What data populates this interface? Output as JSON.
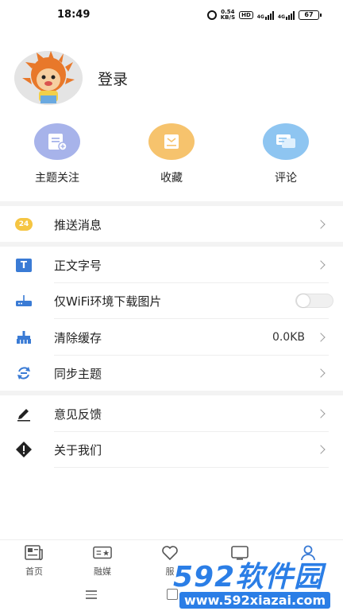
{
  "status_bar": {
    "time": "18:49",
    "speed": "0.54\nKB/S",
    "hd": "HD",
    "network_1": "4G",
    "network_2": "4G",
    "battery": "67"
  },
  "profile": {
    "login_label": "登录"
  },
  "quick_actions": [
    {
      "label": "主题关注",
      "color": "#a7b3ea"
    },
    {
      "label": "收藏",
      "color": "#f6c36d"
    },
    {
      "label": "评论",
      "color": "#8ec5f1"
    }
  ],
  "menu": {
    "push": {
      "label": "推送消息",
      "icon_text": "24"
    },
    "font_size": {
      "label": "正文字号",
      "icon_text": "T"
    },
    "wifi_images": {
      "label": "仅WiFi环境下载图片",
      "enabled": false
    },
    "clear_cache": {
      "label": "清除缓存",
      "value": "0.0KB"
    },
    "sync_topics": {
      "label": "同步主题"
    },
    "feedback": {
      "label": "意见反馈"
    },
    "about": {
      "label": "关于我们"
    }
  },
  "bottom_nav": [
    {
      "label": "首页",
      "icon": "newspaper-icon"
    },
    {
      "label": "融媒",
      "icon": "media-icon"
    },
    {
      "label": "服",
      "icon": "heart-icon"
    },
    {
      "label": "",
      "icon": "tv-icon"
    },
    {
      "label": "",
      "icon": "user-icon"
    }
  ],
  "watermark": {
    "brand": "592软件园",
    "url": "www.592xiazai.com"
  },
  "colors": {
    "accent_blue": "#3a7bd5",
    "push_badge": "#f5c542",
    "watermark_blue": "#2b7ee6"
  }
}
